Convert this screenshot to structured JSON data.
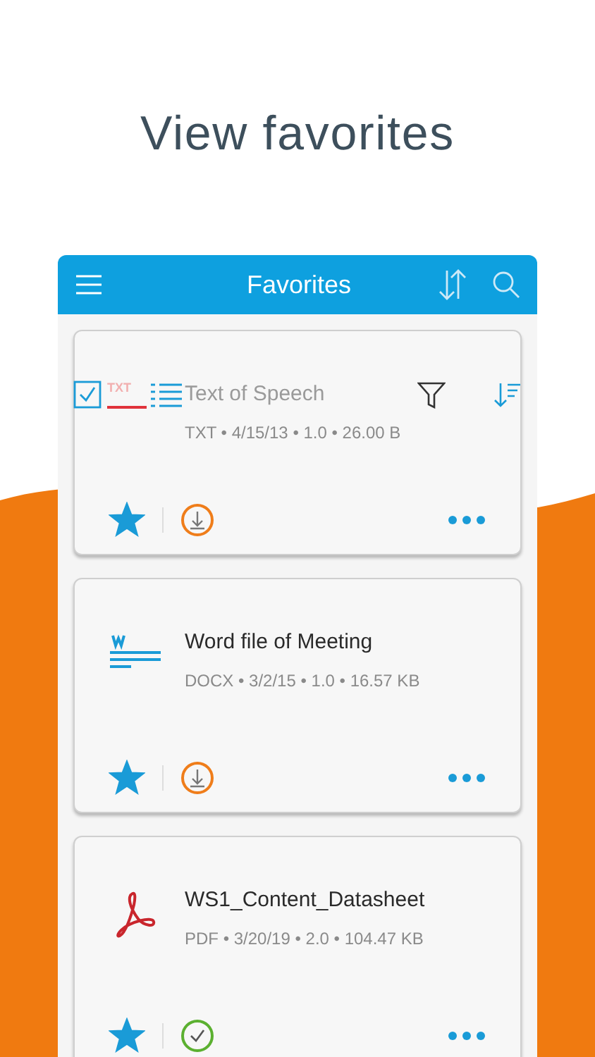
{
  "headline": "View favorites",
  "app_bar": {
    "title": "Favorites"
  },
  "toolbar": {
    "select_checked": true,
    "icon_label": "TXT"
  },
  "files": [
    {
      "kind": "txt",
      "name": "Text of Speech",
      "meta": "TXT • 4/15/13 • 1.0 • 26.00 B",
      "favorite": true,
      "downloaded": false,
      "faded": true
    },
    {
      "kind": "docx",
      "name": "Word file of Meeting",
      "meta": "DOCX • 3/2/15 • 1.0 • 16.57 KB",
      "favorite": true,
      "downloaded": false,
      "faded": false
    },
    {
      "kind": "pdf",
      "name": "WS1_Content_Datasheet",
      "meta": "PDF • 3/20/19 • 2.0 • 104.47 KB",
      "favorite": true,
      "downloaded": true,
      "faded": false
    }
  ]
}
